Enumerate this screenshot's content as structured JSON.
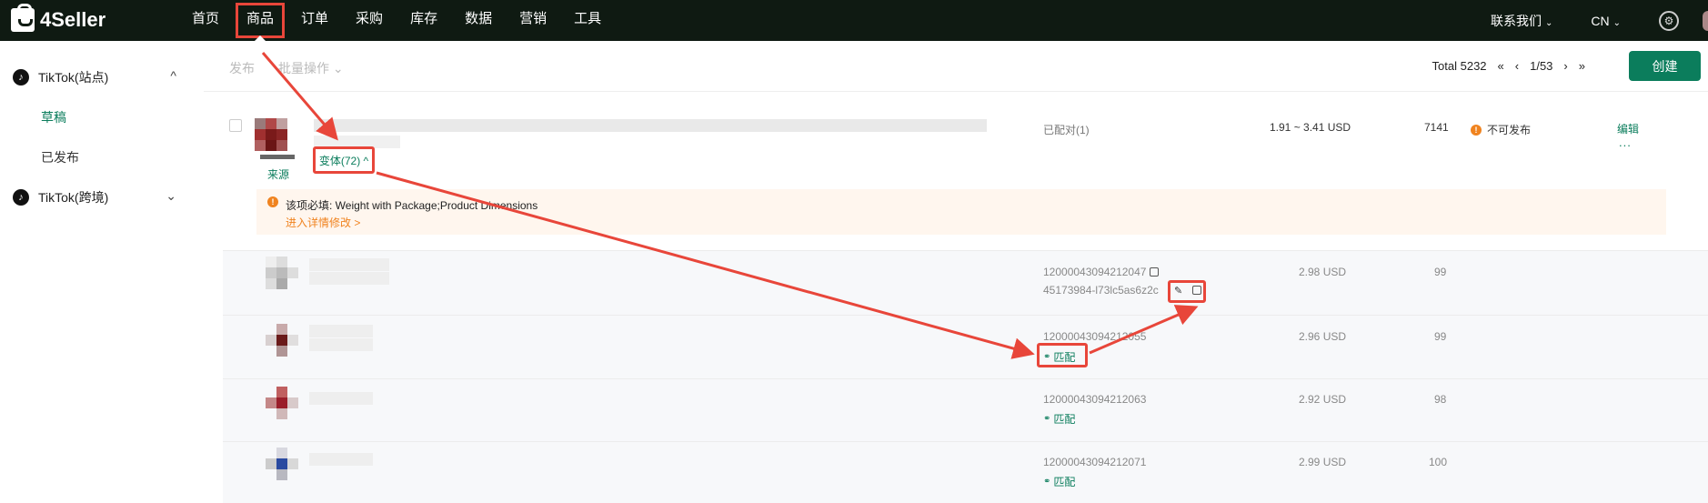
{
  "brand": {
    "name": "4Seller"
  },
  "nav": {
    "items": [
      "首页",
      "商品",
      "订单",
      "采购",
      "库存",
      "数据",
      "营销",
      "工具"
    ],
    "active": "商品"
  },
  "top_right": {
    "contact": "联系我们",
    "lang": "CN",
    "chev": "⌄"
  },
  "sidebar": {
    "groups": [
      {
        "label": "TikTok(站点)",
        "expanded": true,
        "chev": "^",
        "children": [
          "草稿",
          "已发布"
        ],
        "active_child": "草稿"
      },
      {
        "label": "TikTok(跨境)",
        "expanded": false,
        "chev": "⌄",
        "children": []
      }
    ]
  },
  "toolbar": {
    "publish": "发布",
    "bulk": "批量操作 ⌄",
    "total": "Total 5232",
    "first": "«",
    "prev": "‹",
    "page": "1/53",
    "next": "›",
    "last": "»",
    "create": "创建"
  },
  "product": {
    "source_label": "来源",
    "variants_label": "变体(72) ^",
    "matched": "已配对(1)",
    "price_range": "1.91 ~ 3.41 USD",
    "stock": "7141",
    "status": "不可发布",
    "status_icon": "!",
    "edit": "编辑",
    "more": "...",
    "alert": {
      "icon": "!",
      "text": "该项必填: Weight with Package;Product Dimensions",
      "link": "进入详情修改 >"
    }
  },
  "variants": [
    {
      "sku": "12000043094212047",
      "seller_sku": "45173984-l73lc5as6z2c",
      "price": "2.98 USD",
      "qty": "99",
      "matched": true
    },
    {
      "sku": "12000043094212055",
      "match_label": "匹配",
      "price": "2.96 USD",
      "qty": "99"
    },
    {
      "sku": "12000043094212063",
      "match_label": "匹配",
      "price": "2.92 USD",
      "qty": "98"
    },
    {
      "sku": "12000043094212071",
      "match_label": "匹配",
      "price": "2.99 USD",
      "qty": "100"
    }
  ],
  "icons": {
    "link": "🔗",
    "gear": "⚙",
    "tiktok": "♪"
  },
  "colors": {
    "brand_green": "#0b7d5c",
    "annotation_red": "#e8463a",
    "warning_orange": "#f0831f",
    "topbar": "#0f1a12"
  }
}
